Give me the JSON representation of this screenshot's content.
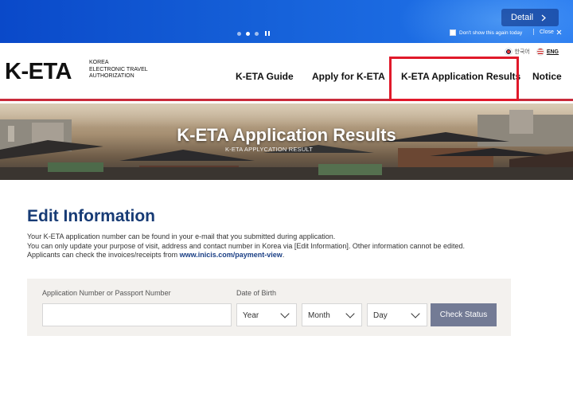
{
  "banner": {
    "detail_label": "Detail",
    "dont_show_label": "Don't show this again today",
    "close_label": "Close",
    "slide_indicator": {
      "count": 3,
      "active": 2
    }
  },
  "header": {
    "logo_text": "K-ETA",
    "logo_sub_line1": "KOREA",
    "logo_sub_line2": "ELECTRONIC TRAVEL",
    "logo_sub_line3": "AUTHORIZATION",
    "lang_korean": "한국어",
    "lang_english": "ENG",
    "nav": {
      "guide": "K-ETA Guide",
      "apply": "Apply for K-ETA",
      "results": "K-ETA Application Results",
      "notice": "Notice"
    },
    "accent_color": "#c92a3a",
    "highlight_color": "#e0192a"
  },
  "hero": {
    "title": "K-ETA Application Results",
    "subtitle": "K-ETA APPLYCATION RESULT"
  },
  "main": {
    "title": "Edit Information",
    "desc_line1": "Your K-ETA application number can be found in your e-mail that you submitted during application.",
    "desc_line2": "You can only update your purpose of visit, address and contact number in Korea via [Edit Information]. Other information cannot be edited.",
    "desc_line3_prefix": "Applicants can check the invoices/receipts from ",
    "desc_link": "www.inicis.com/payment-view",
    "desc_line3_suffix": "."
  },
  "form": {
    "app_label": "Application Number or Passport Number",
    "app_value": "",
    "dob_label": "Date of Birth",
    "year": "Year",
    "month": "Month",
    "day": "Day",
    "check_button": "Check Status"
  }
}
